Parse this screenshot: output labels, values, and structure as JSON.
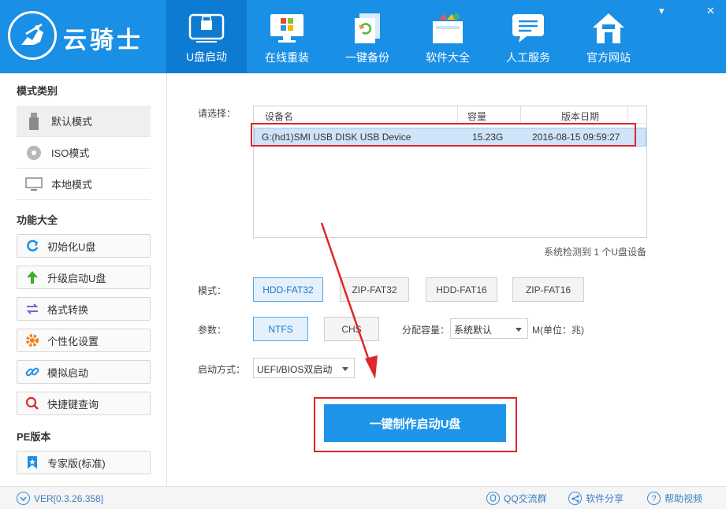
{
  "app": {
    "brand": "云骑士"
  },
  "nav": [
    {
      "label": "U盘启动",
      "icon": "usb-drive-icon"
    },
    {
      "label": "在线重装",
      "icon": "windows-monitor-icon"
    },
    {
      "label": "一键备份",
      "icon": "backup-document-icon"
    },
    {
      "label": "软件大全",
      "icon": "software-box-icon"
    },
    {
      "label": "人工服务",
      "icon": "chat-bubble-icon"
    },
    {
      "label": "官方网站",
      "icon": "home-icon"
    }
  ],
  "window_controls": {
    "minimize": "▾",
    "close": "✕"
  },
  "sidebar": {
    "mode_header": "模式类别",
    "modes": [
      {
        "label": "默认模式",
        "icon": "usb-stick-icon"
      },
      {
        "label": "ISO模式",
        "icon": "disc-icon"
      },
      {
        "label": "本地模式",
        "icon": "monitor-icon"
      }
    ],
    "func_header": "功能大全",
    "functions": [
      {
        "label": "初始化U盘",
        "icon": "refresh-icon"
      },
      {
        "label": "升级启动U盘",
        "icon": "arrow-up-icon"
      },
      {
        "label": "格式转换",
        "icon": "swap-icon"
      },
      {
        "label": "个性化设置",
        "icon": "gear-icon"
      },
      {
        "label": "模拟启动",
        "icon": "link-icon"
      },
      {
        "label": "快捷键查询",
        "icon": "search-icon"
      }
    ],
    "pe_header": "PE版本",
    "pe": {
      "label": "专家版(标准)",
      "icon": "bookmark-icon"
    }
  },
  "main": {
    "select_label": "请选择：",
    "table": {
      "columns": [
        "设备名",
        "容量",
        "版本日期"
      ],
      "rows": [
        {
          "device": "G:(hd1)SMI USB DISK USB Device",
          "capacity": "15.23G",
          "date": "2016-08-15 09:59:27"
        }
      ]
    },
    "detect_text": "系统检测到 1 个U盘设备",
    "mode_label": "模式：",
    "mode_options": [
      "HDD-FAT32",
      "ZIP-FAT32",
      "HDD-FAT16",
      "ZIP-FAT16"
    ],
    "mode_selected": "HDD-FAT32",
    "param_label": "参数：",
    "param_options": [
      "NTFS",
      "CHS"
    ],
    "param_selected": "NTFS",
    "alloc_label": "分配容量：",
    "alloc_value": "系统默认",
    "alloc_unit": "M(单位：兆)",
    "boot_label": "启动方式：",
    "boot_value": "UEFI/BIOS双启动",
    "make_button": "一键制作启动U盘"
  },
  "footer": {
    "version": "VER[0.3.26.358]",
    "qq_group": "QQ交流群",
    "share": "软件分享",
    "help": "帮助视频"
  },
  "colors": {
    "header_blue": "#1a8fe6",
    "active_nav": "#0e7bd2",
    "primary_button": "#1f95ea",
    "annotation_red": "#d9262c",
    "selected_row": "#cfe4f8"
  }
}
